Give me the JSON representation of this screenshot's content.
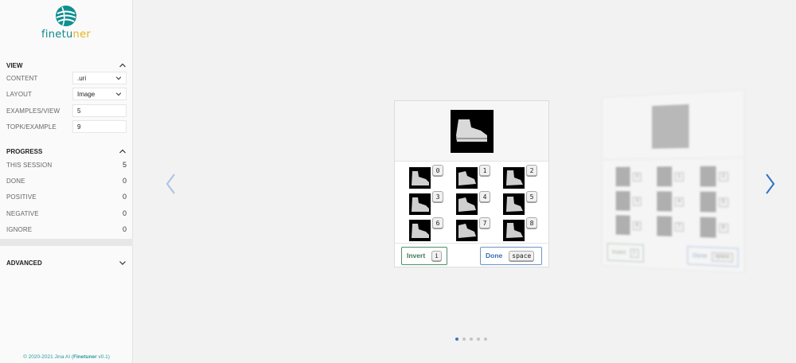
{
  "app": {
    "logo_text_a": "finetu",
    "logo_text_b": "ner",
    "footer_prefix": "© 2020-2021 Jina AI (",
    "footer_brand": "Finetuner",
    "footer_suffix": " v0.1)"
  },
  "sidebar": {
    "view": {
      "title": "VIEW",
      "rows": [
        {
          "label": "CONTENT",
          "value": ".uri"
        },
        {
          "label": "LAYOUT",
          "value": "Image"
        },
        {
          "label": "EXAMPLES/VIEW",
          "value": "5"
        },
        {
          "label": "TOPK/EXAMPLE",
          "value": "9"
        }
      ]
    },
    "progress": {
      "title": "PROGRESS",
      "rows": [
        {
          "label": "THIS SESSION",
          "value": "5"
        },
        {
          "label": "DONE",
          "value": "0"
        },
        {
          "label": "POSITIVE",
          "value": "0"
        },
        {
          "label": "NEGATIVE",
          "value": "0"
        },
        {
          "label": "IGNORE",
          "value": "0"
        }
      ]
    },
    "advanced": {
      "title": "ADVANCED"
    }
  },
  "card": {
    "keys": [
      "0",
      "1",
      "2",
      "3",
      "4",
      "5",
      "6",
      "7",
      "8"
    ],
    "invert_label": "Invert",
    "invert_key": "i",
    "done_label": "Done",
    "done_key": "space"
  },
  "ghost": {
    "keys": [
      "0",
      "1",
      "2",
      "3",
      "4",
      "5",
      "6",
      "7",
      "8"
    ],
    "invert_label": "Invert",
    "invert_key": "i",
    "done_label": "Done",
    "done_key": "space"
  },
  "pagination": {
    "count": 5,
    "active": 0
  },
  "colors": {
    "accent": "#3a78c6",
    "brand_teal": "#0e8a8a",
    "brand_yellow": "#e5b521",
    "invert": "#3f7a55"
  }
}
